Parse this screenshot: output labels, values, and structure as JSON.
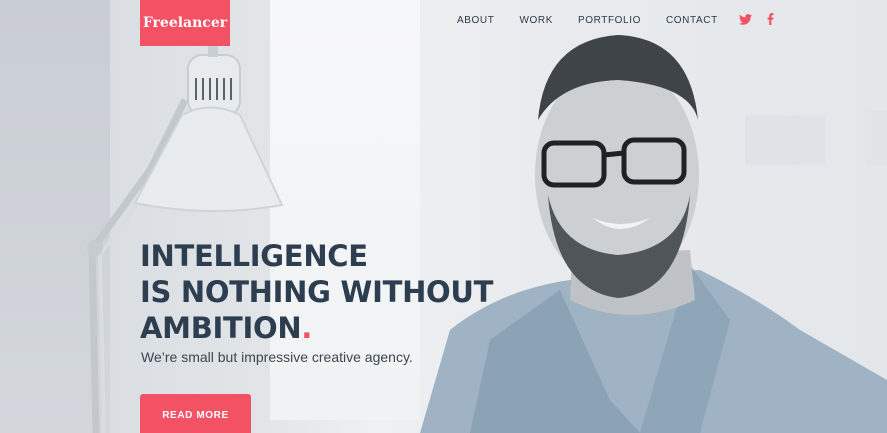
{
  "brand": {
    "logo_text": "Freelancer",
    "accent_color": "#f25264",
    "text_color": "#2d3e50"
  },
  "nav": {
    "items": [
      "ABOUT",
      "WORK",
      "PORTFOLIO",
      "CONTACT"
    ],
    "social": [
      {
        "icon": "twitter-icon",
        "glyph": "🐦"
      },
      {
        "icon": "facebook-icon",
        "glyph": "f"
      }
    ]
  },
  "hero": {
    "headline_line1": "INTELLIGENCE",
    "headline_line2": "IS NOTHING WITHOUT",
    "headline_line3": "AMBITION",
    "headline_dot": ".",
    "subtitle": "We’re small but impressive creative agency.",
    "cta_label": "READ MORE"
  }
}
